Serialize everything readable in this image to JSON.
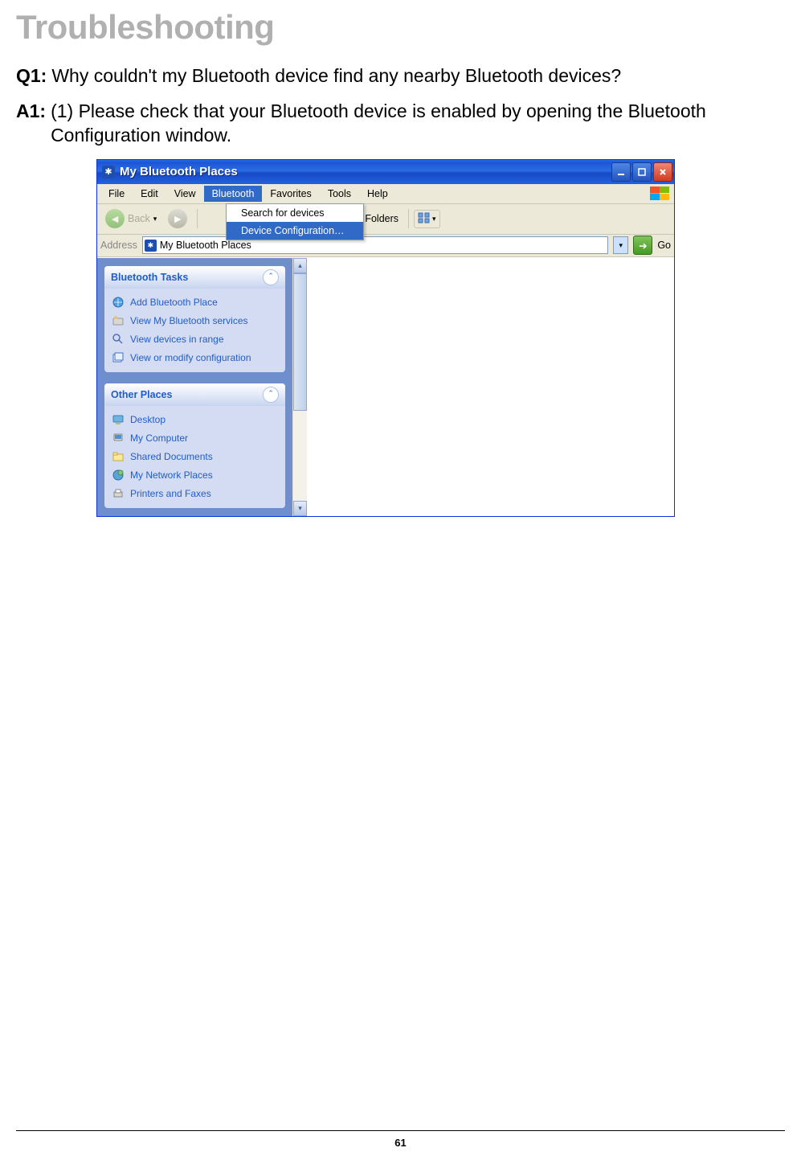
{
  "page": {
    "heading": "Troubleshooting",
    "q1_label": "Q1:",
    "q1_text": "Why couldn't my Bluetooth device find any nearby Bluetooth devices?",
    "a1_label": "A1:",
    "a1_text": "(1) Please check that your Bluetooth device is enabled by opening the Bluetooth Configuration window.",
    "page_number": "61"
  },
  "window": {
    "title": "My Bluetooth Places",
    "menus": {
      "file": "File",
      "edit": "Edit",
      "view": "View",
      "bluetooth": "Bluetooth",
      "favorites": "Favorites",
      "tools": "Tools",
      "help": "Help"
    },
    "dropdown": {
      "item1": "Search for devices",
      "item2": "Device Configuration…"
    },
    "toolbar": {
      "back": "Back",
      "folders": "Folders"
    },
    "addressbar": {
      "label": "Address",
      "path": "My Bluetooth Places",
      "go": "Go"
    },
    "sidebar": {
      "panel1_title": "Bluetooth Tasks",
      "tasks1": {
        "t1": "Add Bluetooth Place",
        "t2": "View My Bluetooth services",
        "t3": "View devices in range",
        "t4": "View or modify configuration"
      },
      "panel2_title": "Other Places",
      "tasks2": {
        "t1": "Desktop",
        "t2": "My Computer",
        "t3": "Shared Documents",
        "t4": "My Network Places",
        "t5": "Printers and Faxes"
      }
    }
  }
}
